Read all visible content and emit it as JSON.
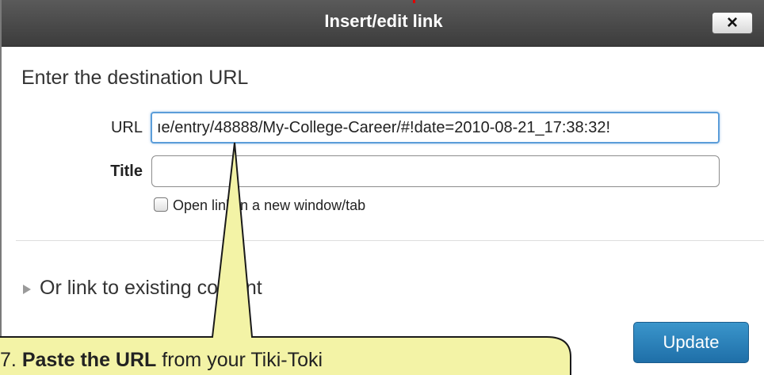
{
  "dialog": {
    "title": "Insert/edit link",
    "close_label": "×",
    "heading": "Enter the destination URL",
    "url_label": "URL",
    "url_value": "ıe/entry/48888/My-College-Career/#!date=2010-08-21_17:38:32!",
    "title_label": "Title",
    "title_value": "",
    "new_window_label": "Open link in a new window/tab",
    "existing_content_label": "Or link to existing content",
    "update_button": "Update"
  },
  "callout": {
    "step": "7.",
    "bold_text": "Paste the URL",
    "rest_text": "from your Tiki-Toki"
  },
  "colors": {
    "titlebar": "#3c3c3c",
    "accent": "#5b9dd9",
    "update_button": "#2a84bf",
    "callout_fill": "#f3f3a6"
  },
  "icons": {
    "close": "close-icon",
    "expand": "triangle-right-icon"
  }
}
